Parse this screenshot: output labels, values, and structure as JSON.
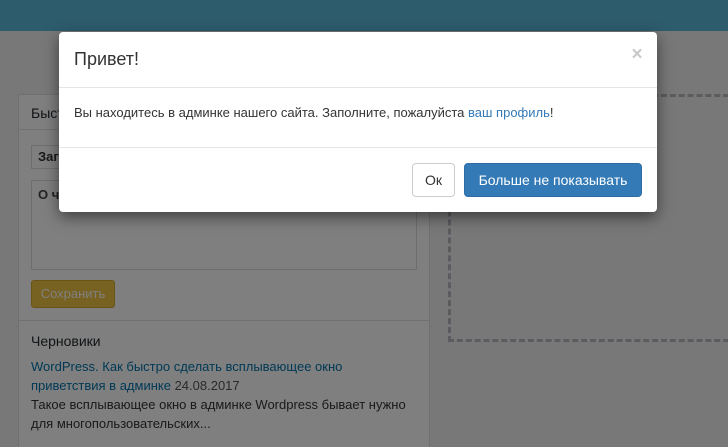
{
  "background": {
    "quick_draft": {
      "title_partial": "Быст",
      "title_field_value": "Заг",
      "content_field_value": "О ч",
      "save_label": "Сохранить"
    },
    "drafts": {
      "heading": "Черновики",
      "items": [
        {
          "link": "WordPress. Как быстро сделать всплывающее окно приветствия в админке",
          "date": "24.08.2017",
          "excerpt": "Такое всплывающее окно в админке Wordpress бывает нужно для многопользовательских..."
        }
      ]
    }
  },
  "modal": {
    "title": "Привет!",
    "close_symbol": "×",
    "body": {
      "text_before": "Вы находитесь в админке нашего сайта. Заполните, пожалуйста ",
      "link_text": "ваш профиль",
      "text_after": "!"
    },
    "buttons": {
      "ok": "Ок",
      "dont_show": "Больше не показывать"
    }
  },
  "colors": {
    "topbar": "#5bb8db",
    "primary_button": "#337ab7",
    "save_button": "#f0c445",
    "link": "#337ab7"
  }
}
